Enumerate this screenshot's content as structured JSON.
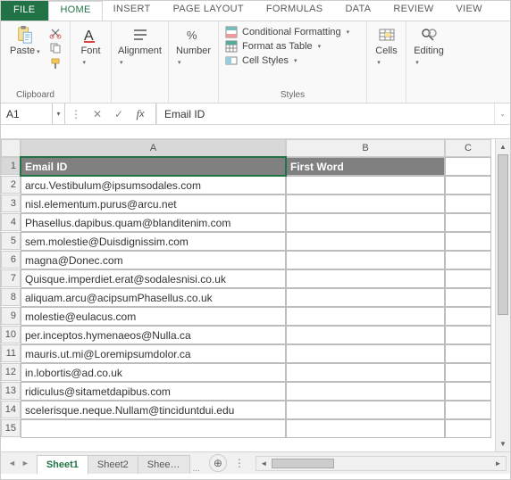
{
  "tabs": {
    "file": "FILE",
    "items": [
      "HOME",
      "INSERT",
      "PAGE LAYOUT",
      "FORMULAS",
      "DATA",
      "REVIEW",
      "VIEW"
    ],
    "active": "HOME"
  },
  "ribbon": {
    "clipboard": {
      "label": "Clipboard",
      "paste": "Paste"
    },
    "font": {
      "label": "Font",
      "btn": "Font"
    },
    "alignment": {
      "label": "",
      "btn": "Alignment"
    },
    "number": {
      "label": "",
      "btn": "Number"
    },
    "styles": {
      "label": "Styles",
      "cond": "Conditional Formatting",
      "table": "Format as Table",
      "cell": "Cell Styles"
    },
    "cells": {
      "btn": "Cells"
    },
    "editing": {
      "btn": "Editing"
    }
  },
  "namebox": "A1",
  "formula": "Email ID",
  "columns": [
    "A",
    "B",
    "C"
  ],
  "headers": {
    "a": "Email ID",
    "b": "First Word"
  },
  "rows": [
    "arcu.Vestibulum@ipsumsodales.com",
    "nisl.elementum.purus@arcu.net",
    "Phasellus.dapibus.quam@blanditenim.com",
    "sem.molestie@Duisdignissim.com",
    "magna@Donec.com",
    "Quisque.imperdiet.erat@sodalesnisi.co.uk",
    "aliquam.arcu@acipsumPhasellus.co.uk",
    "molestie@eulacus.com",
    "per.inceptos.hymenaeos@Nulla.ca",
    "mauris.ut.mi@Loremipsumdolor.ca",
    "in.lobortis@ad.co.uk",
    "ridiculus@sitametdapibus.com",
    "scelerisque.neque.Nullam@tinciduntdui.edu"
  ],
  "sheets": {
    "items": [
      "Sheet1",
      "Sheet2",
      "Shee…"
    ],
    "active": "Sheet1",
    "more": "..."
  }
}
